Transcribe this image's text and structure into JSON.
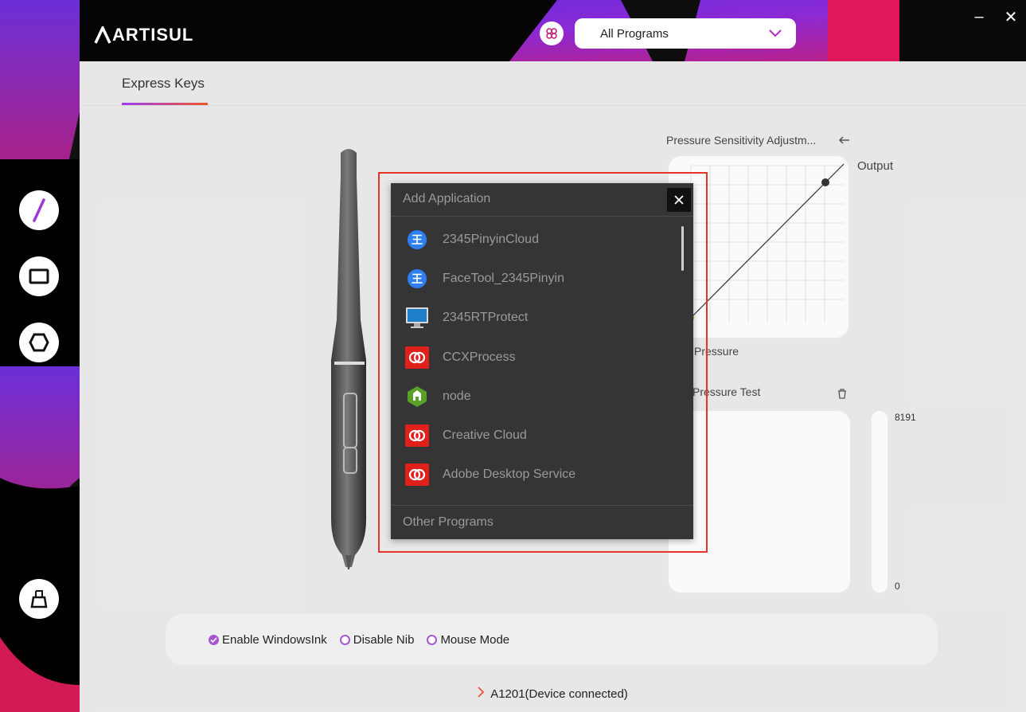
{
  "app": {
    "brand": "ARTISUL"
  },
  "window": {
    "minimize": "–",
    "close": "✕"
  },
  "header": {
    "program_select": "All Programs",
    "program_chevron": "⌄"
  },
  "tabs": [
    {
      "label": "Express Keys"
    }
  ],
  "pressure": {
    "title": "Pressure Sensitivity Adjustm...",
    "output_label": "Output",
    "pressure_label": "Pressure"
  },
  "pressure_test": {
    "title": "Pressure Test",
    "max": "8191",
    "min": "0"
  },
  "modes": [
    {
      "label": "Enable WindowsInk",
      "checked": true
    },
    {
      "label": "Disable Nib",
      "checked": false
    },
    {
      "label": "Mouse Mode",
      "checked": false
    }
  ],
  "device": {
    "status": "A1201(Device connected)"
  },
  "popup": {
    "title": "Add Application",
    "close": "✕",
    "apps": [
      {
        "name": "2345PinyinCloud",
        "icon": "pinyin-icon"
      },
      {
        "name": "FaceTool_2345Pinyin",
        "icon": "pinyin-icon"
      },
      {
        "name": "2345RTProtect",
        "icon": "monitor-icon"
      },
      {
        "name": "CCXProcess",
        "icon": "adobe-cc-icon"
      },
      {
        "name": "node",
        "icon": "node-icon"
      },
      {
        "name": "Creative Cloud",
        "icon": "adobe-cc-icon"
      },
      {
        "name": "Adobe Desktop Service",
        "icon": "adobe-cc-icon"
      }
    ],
    "footer": "Other Programs"
  },
  "colors": {
    "accent_purple": "#a855d6",
    "accent_orange": "#f0552e",
    "highlight_red": "#e8332c",
    "popup_bg": "#353535"
  }
}
